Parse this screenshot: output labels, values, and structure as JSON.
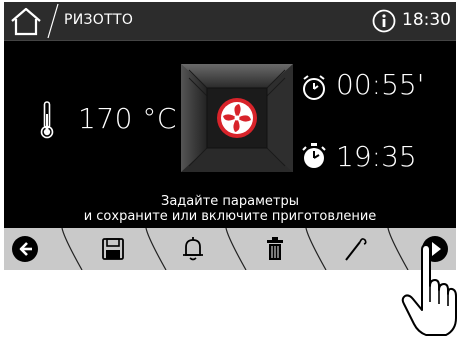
{
  "header": {
    "title": "РИЗОТТО",
    "clock": "18:30"
  },
  "main": {
    "temperature": "170 °C",
    "timer": "00:55'",
    "end_time": "19:35",
    "message_line1": "Задайте параметры",
    "message_line2": "и сохраните или включите приготовление"
  },
  "colors": {
    "fan_red": "#d8232a",
    "toolbar_bg": "#c9c9c9",
    "header_bg": "#2c2c2c"
  },
  "icons": [
    "home-icon",
    "info-icon",
    "thermometer-icon",
    "fan-icon",
    "timer-icon",
    "end-time-icon",
    "back-icon",
    "save-icon",
    "bell-icon",
    "trash-icon",
    "probe-icon",
    "play-icon",
    "hand-cursor-icon"
  ]
}
